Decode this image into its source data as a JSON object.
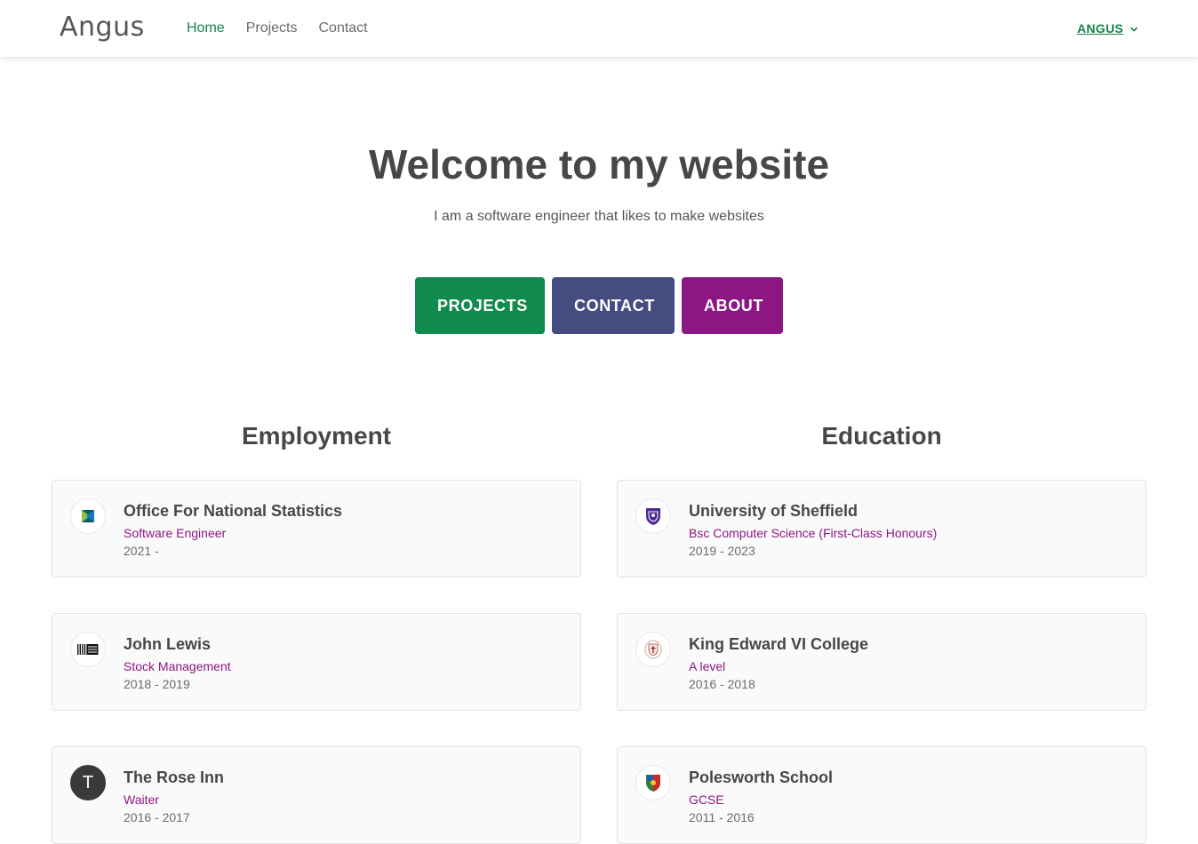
{
  "nav": {
    "brand": "Angus",
    "links": [
      "Home",
      "Projects",
      "Contact"
    ],
    "user": "ANGUS"
  },
  "hero": {
    "title": "Welcome to my website",
    "subtitle": "I am a software engineer that likes to make websites",
    "buttons": {
      "projects": "PROJECTS",
      "contact": "CONTACT",
      "about": "ABOUT"
    }
  },
  "employment": {
    "title": "Employment",
    "items": [
      {
        "name": "Office For National Statistics",
        "role": "Software Engineer",
        "dates": "2021 -"
      },
      {
        "name": "John Lewis",
        "role": "Stock Management",
        "dates": "2018 - 2019"
      },
      {
        "name": "The Rose Inn",
        "role": "Waiter",
        "dates": "2016 - 2017",
        "initial": "T"
      }
    ]
  },
  "education": {
    "title": "Education",
    "items": [
      {
        "name": "University of Sheffield",
        "role": "Bsc Computer Science (First-Class Honours)",
        "dates": "2019 - 2023"
      },
      {
        "name": "King Edward VI College",
        "role": "A level",
        "dates": "2016 - 2018"
      },
      {
        "name": "Polesworth School",
        "role": "GCSE",
        "dates": "2011 - 2016"
      }
    ]
  },
  "colors": {
    "accent_green": "#118a4e",
    "contact_blue": "#454d80",
    "about_purple": "#8d1782"
  }
}
